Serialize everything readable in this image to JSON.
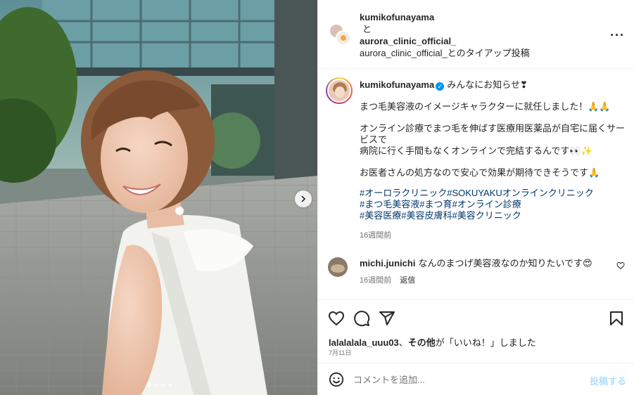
{
  "header": {
    "user1": "kumikofunayama",
    "conjunction": "と",
    "user2": "aurora_clinic_official_",
    "tieup_text": "aurora_clinic_official_とのタイアップ投稿"
  },
  "caption": {
    "username": "kumikofunayama",
    "verified": "✓",
    "first_line": "みんなにお知らせ❣",
    "para1": "まつ毛美容液のイメージキャラクターに就任しました！🙏🙏",
    "para2": "オンライン診療でまつ毛を伸ばす医療用医薬品が自宅に届くサービスで\n病院に行く手間もなくオンラインで完結するんです👀✨",
    "para3": "お医者さんの処方なので安心で効果が期待できそうです🙏",
    "hashtags": "#オーロラクリニック#SOKUYAKUオンラインクリニック\n#まつ毛美容液#まつ育#オンライン診療\n#美容医療#美容皮膚科#美容クリニック",
    "time": "16週間前"
  },
  "comment": {
    "username": "michi.junichi",
    "text": "なんのまつげ美容液なのか知りたいです😍",
    "time": "16週間前",
    "reply": "返信"
  },
  "likes": {
    "user": "lalalalala_uuu03",
    "separator": "、",
    "others": "その他",
    "suffix": "が「いいね！」しました",
    "date": "7月11日"
  },
  "composer": {
    "placeholder": "コメントを追加...",
    "post_label": "投稿する"
  },
  "icons": {
    "like": "heart-icon",
    "comment": "comment-icon",
    "share": "share-icon",
    "save": "bookmark-icon",
    "emoji": "emoji-icon",
    "more": "more-icon",
    "next": "chevron-right-icon"
  },
  "carousel": {
    "slides": 4,
    "active_index": 0
  },
  "colors": {
    "link": "#00376b",
    "verified": "#0095f6",
    "muted": "#737373",
    "post_button_disabled": "#b2dffc"
  }
}
